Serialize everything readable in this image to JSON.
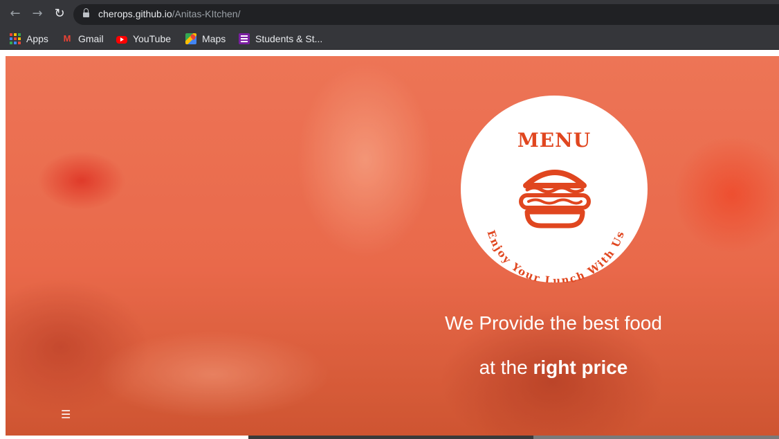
{
  "browser": {
    "url_host": "cherops.github.io",
    "url_path": "/Anitas-KItchen/",
    "bookmarks": [
      {
        "label": "Apps",
        "icon": "apps-grid-icon"
      },
      {
        "label": "Gmail",
        "icon": "gmail-icon"
      },
      {
        "label": "YouTube",
        "icon": "youtube-icon"
      },
      {
        "label": "Maps",
        "icon": "maps-icon"
      },
      {
        "label": "Students & St...",
        "icon": "list-icon"
      }
    ]
  },
  "hero": {
    "badge_title": "MENU",
    "badge_arc_text": "Enjoy Your Lunch With Us",
    "tagline_line1": "We Provide the best food",
    "tagline_line2_prefix": "at the ",
    "tagline_line2_bold": "right price",
    "menu_toggle": "☰"
  },
  "colors": {
    "accent": "#e0461f",
    "overlay": "#ea6c4e",
    "chrome": "#35363a"
  }
}
